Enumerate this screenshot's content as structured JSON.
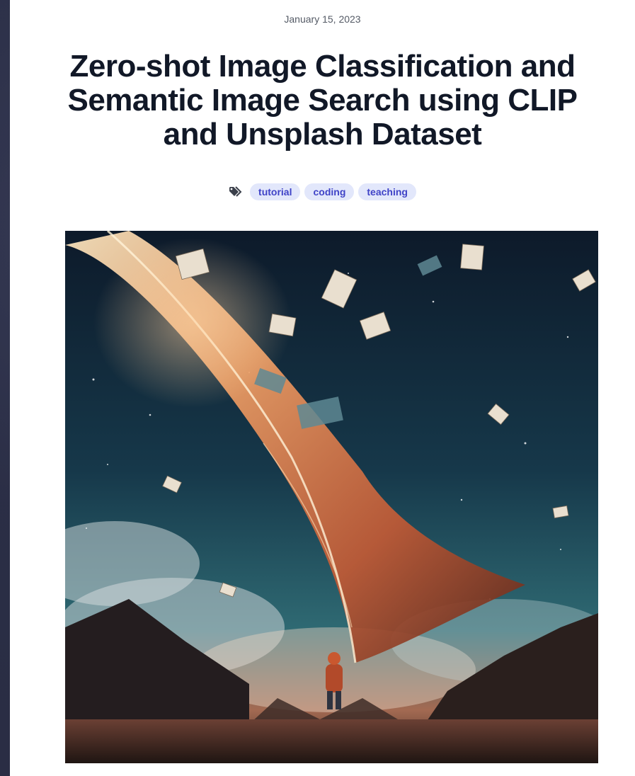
{
  "post": {
    "date": "January 15, 2023",
    "title": "Zero-shot Image Classification and Semantic Image Search using CLIP and Unsplash Dataset",
    "tags_icon": "tags-icon",
    "tags": [
      "tutorial",
      "coding",
      "teaching"
    ]
  },
  "hero_image": {
    "icon": "illustration-image"
  }
}
